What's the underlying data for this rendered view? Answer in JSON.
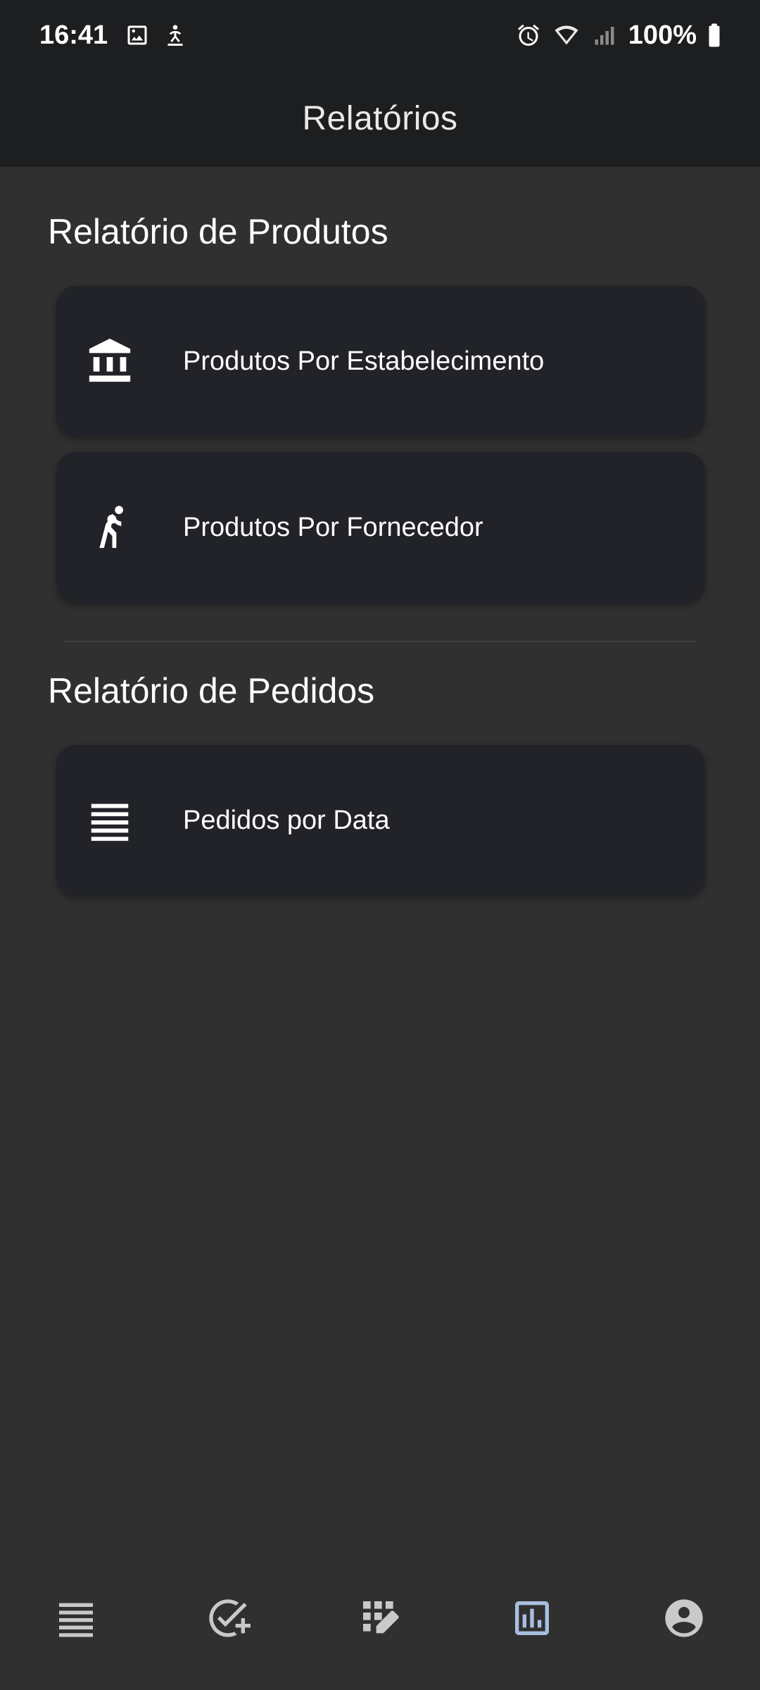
{
  "status_bar": {
    "time": "16:41",
    "battery": "100%",
    "icons": [
      "image-icon",
      "accessibility-icon",
      "alarm-icon",
      "wifi-icon",
      "signal-icon",
      "battery-icon"
    ]
  },
  "app_bar": {
    "title": "Relatórios"
  },
  "sections": [
    {
      "title": "Relatório de Produtos",
      "items": [
        {
          "label": "Produtos Por Estabelecimento",
          "icon": "bank-icon"
        },
        {
          "label": "Produtos Por Fornecedor",
          "icon": "handball-icon"
        }
      ]
    },
    {
      "title": "Relatório de Pedidos",
      "items": [
        {
          "label": "Pedidos por Data",
          "icon": "list-icon"
        }
      ]
    }
  ],
  "bottom_nav": {
    "items": [
      {
        "icon": "list-icon",
        "active": false
      },
      {
        "icon": "add-task-icon",
        "active": false
      },
      {
        "icon": "edit-grid-icon",
        "active": false
      },
      {
        "icon": "bar-chart-icon",
        "active": true
      },
      {
        "icon": "account-icon",
        "active": false
      }
    ]
  },
  "colors": {
    "background": "#303030",
    "bar": "#1d1e20",
    "card": "#212328",
    "nav_icon": "#c9c9c9",
    "nav_icon_active": "#a9bfe0"
  }
}
